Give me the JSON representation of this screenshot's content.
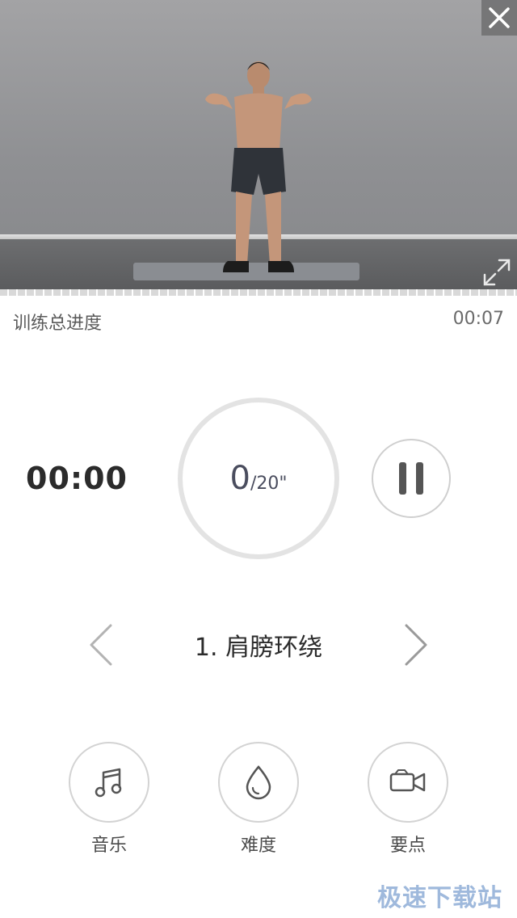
{
  "video": {
    "close_icon": "close-icon",
    "fullscreen_icon": "fullscreen-expand-icon"
  },
  "progress": {
    "label": "训练总进度",
    "time": "00:07"
  },
  "timer": {
    "elapsed": "00:00"
  },
  "counter": {
    "current": "0",
    "total": "/20\""
  },
  "controls": {
    "pause_icon": "pause-icon",
    "prev_icon": "chevron-left-icon",
    "next_icon": "chevron-right-icon"
  },
  "exercise": {
    "name": "1. 肩膀环绕"
  },
  "actions": [
    {
      "label": "音乐",
      "icon": "music-note-icon"
    },
    {
      "label": "难度",
      "icon": "water-drop-icon"
    },
    {
      "label": "要点",
      "icon": "video-camera-icon"
    }
  ],
  "watermark": "极速下载站",
  "colors": {
    "ring": "#e3e3e3",
    "button_border": "#d3d3d3",
    "counter_text": "#4a4d5e",
    "watermark": "#9fb9dc"
  }
}
